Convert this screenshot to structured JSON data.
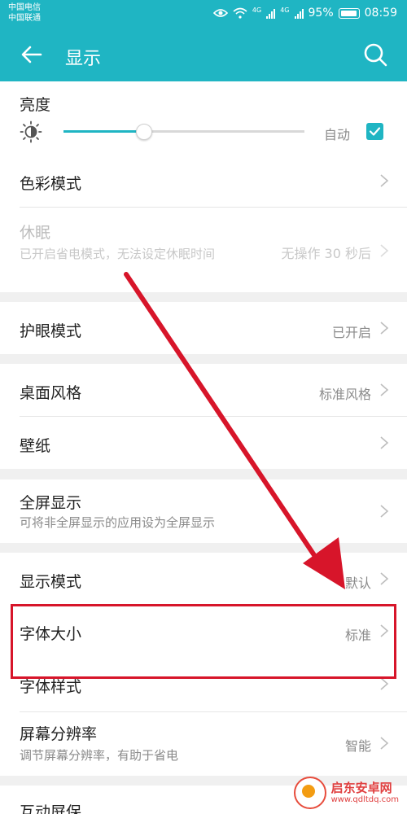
{
  "status_bar": {
    "carrier_1": "中国电信",
    "carrier_2": "中国联通",
    "net_1": "4G",
    "net_2": "4G",
    "battery": "95%",
    "time": "08:59"
  },
  "app_bar": {
    "title": "显示"
  },
  "brightness": {
    "label": "亮度",
    "auto_label": "自动",
    "auto_checked": true,
    "level": 0.33
  },
  "items": {
    "color_mode": {
      "label": "色彩模式"
    },
    "sleep": {
      "label": "休眠",
      "sub": "已开启省电模式，无法设定休眠时间",
      "value": "无操作 30 秒后"
    },
    "eye_comfort": {
      "label": "护眼模式",
      "value": "已开启"
    },
    "home_style": {
      "label": "桌面风格",
      "value": "标准风格"
    },
    "wallpaper": {
      "label": "壁纸"
    },
    "fullscreen": {
      "label": "全屏显示",
      "sub": "可将非全屏显示的应用设为全屏显示"
    },
    "display_mode": {
      "label": "显示模式",
      "value": "默认"
    },
    "font_size": {
      "label": "字体大小",
      "value": "标准"
    },
    "font_style": {
      "label": "字体样式"
    },
    "resolution": {
      "label": "屏幕分辨率",
      "sub": "调节屏幕分辨率，有助于省电",
      "value": "智能"
    },
    "screensaver": {
      "label": "互动屏保"
    }
  },
  "colors": {
    "accent": "#1fb5c3",
    "annotation": "#d7152a"
  },
  "watermark": {
    "name": "启东安卓网",
    "url": "www.qdltdq.com"
  }
}
